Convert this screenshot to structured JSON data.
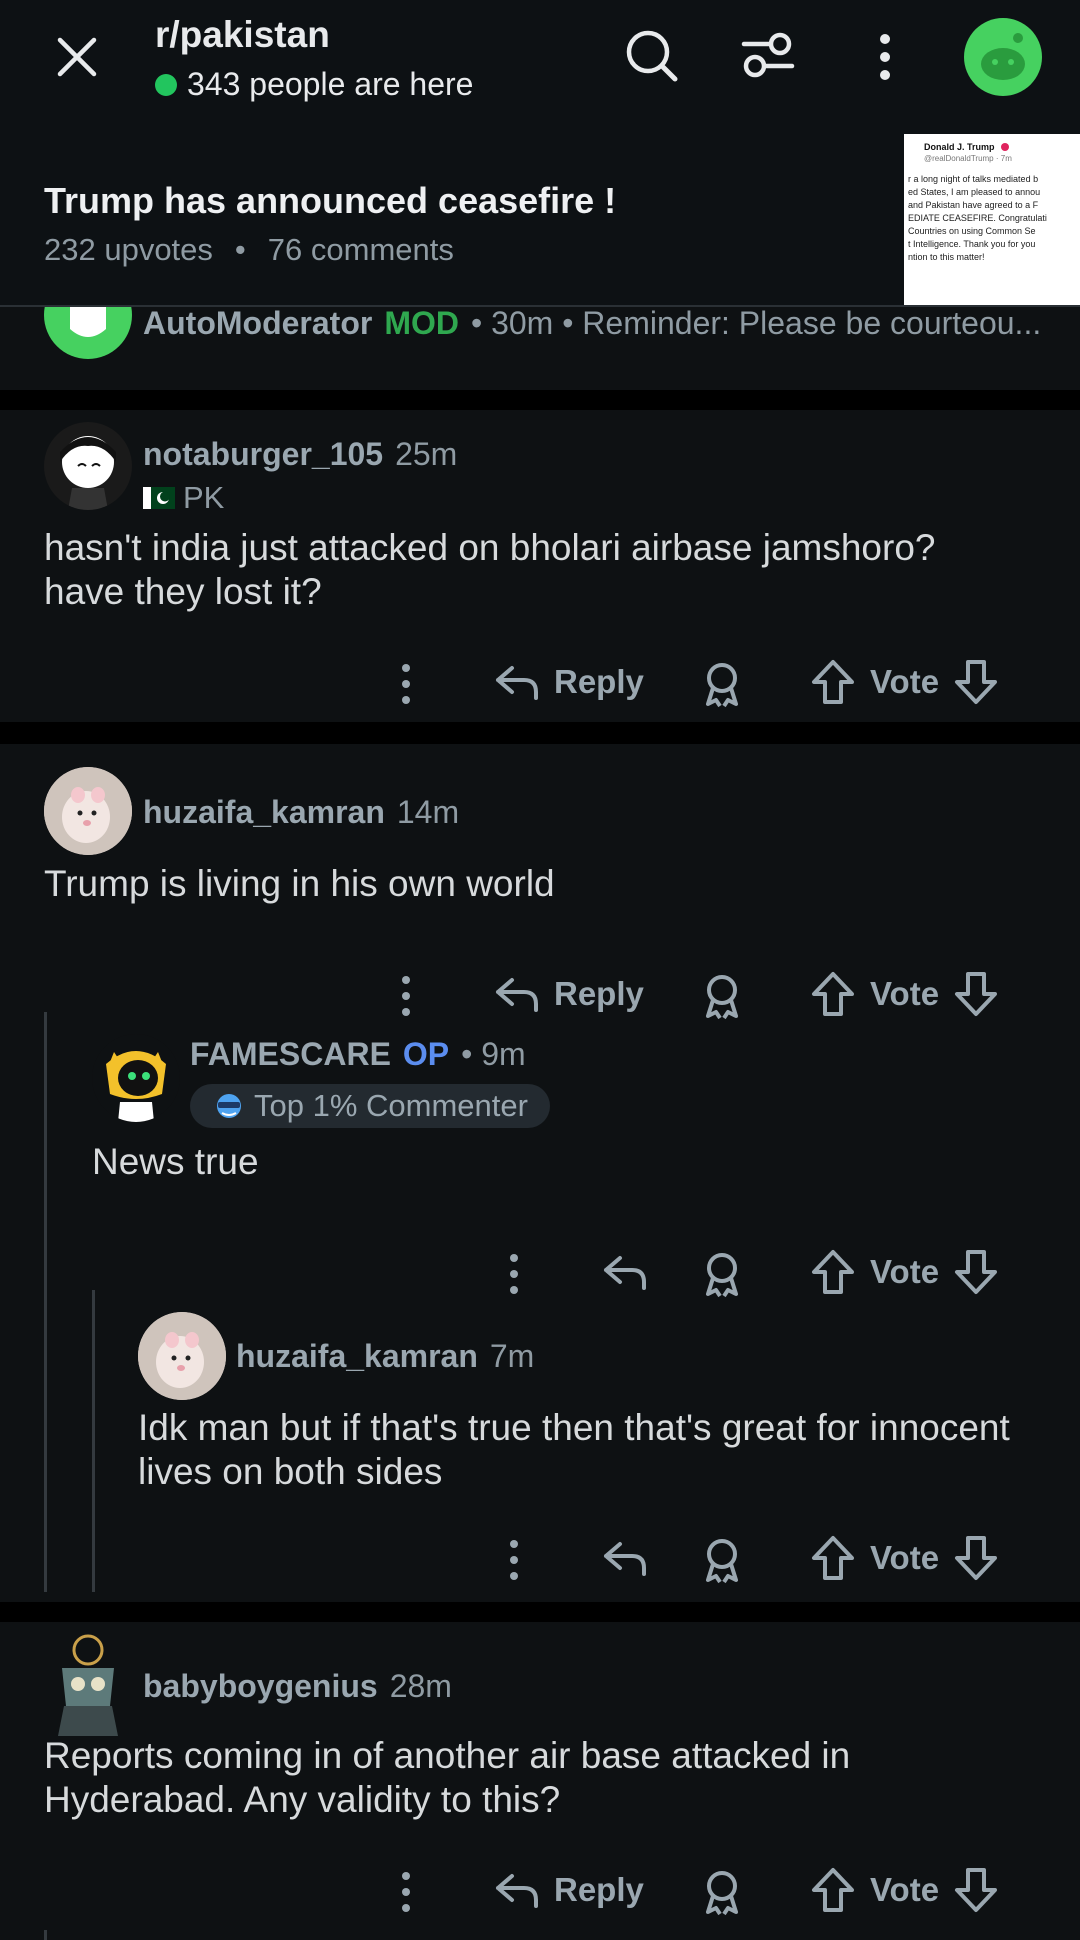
{
  "header": {
    "subreddit": "r/pakistan",
    "online_text": "343 people are here",
    "post_title": "Trump has announced ceasefire !",
    "upvotes": "232 upvotes",
    "comments": "76 comments",
    "separator": "•",
    "thumbnail": {
      "author": "Donald J. Trump",
      "handle": "@realDonaldTrump · 7m",
      "lines": [
        "r a long night of talks mediated b",
        "ed States, I am pleased to annou",
        "and Pakistan have agreed to a F",
        "EDIATE CEASEFIRE. Congratulati",
        "Countries on using Common Se",
        "t Intelligence. Thank you for you",
        "ntion to this matter!"
      ]
    }
  },
  "automod": {
    "username": "AutoModerator",
    "badge": "MOD",
    "meta": "• 30m • Reminder: Please be courteou..."
  },
  "comments": [
    {
      "username": "notaburger_105",
      "time": "25m",
      "flair": "PK",
      "text_lines": [
        "hasn't india just attacked on bholari airbase jamshoro?",
        "have they lost it?"
      ],
      "reply_label": "Reply",
      "vote_label": "Vote"
    },
    {
      "username": "huzaifa_kamran",
      "time": "14m",
      "text_lines": [
        "Trump is living in his own world"
      ],
      "reply_label": "Reply",
      "vote_label": "Vote"
    },
    {
      "username": "FAMESCARE",
      "badge": "OP",
      "time": "• 9m",
      "flair": "Top 1% Commenter",
      "text_lines": [
        "News true"
      ],
      "vote_label": "Vote"
    },
    {
      "username": "huzaifa_kamran",
      "time": "7m",
      "text_lines": [
        "Idk man but if that's true then that's great for innocent",
        "lives on both sides"
      ],
      "vote_label": "Vote"
    },
    {
      "username": "babyboygenius",
      "time": "28m",
      "text_lines": [
        "Reports coming in of another air base attacked in",
        "Hyderabad. Any validity to this?"
      ],
      "reply_label": "Reply",
      "vote_label": "Vote"
    }
  ],
  "colors": {
    "online_dot": "#22c55e",
    "mod_green": "#2fa84f",
    "op_blue": "#5b8def",
    "avatar_green": "#46d160"
  },
  "icons": [
    "close-icon",
    "search-icon",
    "filter-icon",
    "more-vertical-icon",
    "user-avatar-icon",
    "reply-icon",
    "award-icon",
    "upvote-icon",
    "downvote-icon"
  ]
}
